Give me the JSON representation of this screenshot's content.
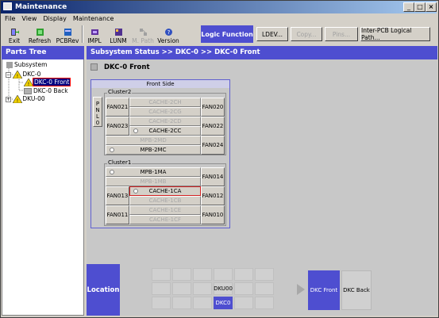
{
  "window": {
    "title": "Maintenance"
  },
  "menu": [
    "File",
    "View",
    "Display",
    "Maintenance"
  ],
  "toolbar": {
    "buttons": [
      {
        "label": "Exit",
        "icon": "exit-icon"
      },
      {
        "label": "Refresh",
        "icon": "refresh-icon"
      },
      {
        "label": "PCBRev",
        "icon": "pcbrev-icon"
      },
      {
        "label": "IMPL",
        "icon": "impl-icon"
      },
      {
        "label": "LUNM",
        "icon": "lunm-icon"
      },
      {
        "label": "M. Path",
        "icon": "mpath-icon",
        "disabled": true
      },
      {
        "label": "Version",
        "icon": "version-icon"
      }
    ],
    "logic_function": "Logic Function",
    "logic_buttons": [
      {
        "label": "LDEV...",
        "disabled": false
      },
      {
        "label": "Copy...",
        "disabled": true
      },
      {
        "label": "Pins...",
        "disabled": true
      },
      {
        "label": "Inter-PCB Logical Path...",
        "disabled": false
      }
    ]
  },
  "parts_tree": {
    "title": "Parts Tree",
    "items": [
      {
        "label": "Subsystem",
        "level": 0
      },
      {
        "label": "DKC-0",
        "level": 1
      },
      {
        "label": "DKC-0 Front",
        "level": 2,
        "selected": true
      },
      {
        "label": "DKC-0 Back",
        "level": 2
      },
      {
        "label": "DKU-00",
        "level": 1
      }
    ]
  },
  "subsystem_status": {
    "header": "Subsystem Status >> DKC-0 >> DKC-0 Front",
    "title": "DKC-0 Front",
    "front_side_label": "Front Side",
    "pnl_label": "PNL0",
    "cluster2": {
      "label": "Cluster2",
      "fans_left": [
        "FAN021",
        "FAN023"
      ],
      "fans_right": [
        "FAN020",
        "FAN022",
        "FAN024"
      ],
      "slots": [
        {
          "label": "CACHE-2CH",
          "disabled": true
        },
        {
          "label": "CACHE-2CG",
          "disabled": true
        },
        {
          "label": "CACHE-2CD",
          "disabled": true
        },
        {
          "label": "CACHE-2CC",
          "disabled": false,
          "radio": true
        },
        {
          "label": "MPB-2MD",
          "disabled": true
        },
        {
          "label": "MPB-2MC",
          "disabled": false,
          "radio": true
        }
      ]
    },
    "cluster1": {
      "label": "Cluster1",
      "fans_left": [
        "FAN013",
        "FAN011"
      ],
      "fans_right": [
        "FAN014",
        "FAN012",
        "FAN010"
      ],
      "slots": [
        {
          "label": "MPB-1MA",
          "disabled": false,
          "radio": true
        },
        {
          "label": "MPB-1MB",
          "disabled": true
        },
        {
          "label": "CACHE-1CA",
          "disabled": false,
          "radio": true,
          "highlighted": true
        },
        {
          "label": "CACHE-1CB",
          "disabled": true
        },
        {
          "label": "CACHE-1CE",
          "disabled": true
        },
        {
          "label": "CACHE-1CF",
          "disabled": true
        }
      ]
    }
  },
  "location": {
    "label": "Location",
    "dku_label": "DKU00",
    "dkc_label": "DKC0",
    "dkc_front": "DKC Front",
    "dkc_back": "DKC Back"
  }
}
